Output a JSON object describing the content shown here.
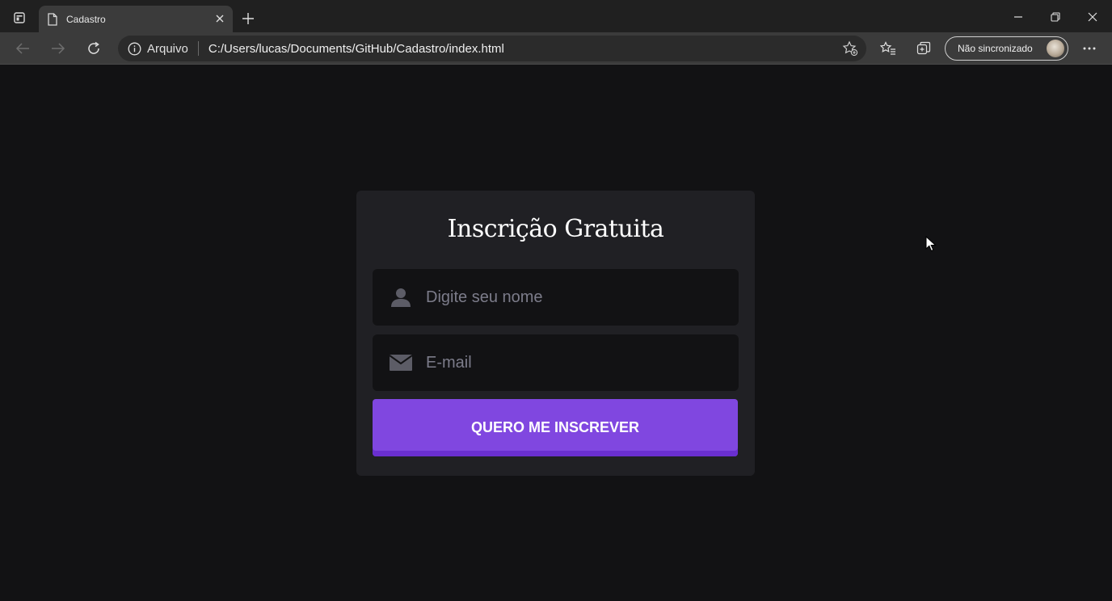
{
  "browser": {
    "tab_title": "Cadastro",
    "address_label": "Arquivo",
    "url": "C:/Users/lucas/Documents/GitHub/Cadastro/index.html",
    "sync_label": "Não sincronizado"
  },
  "form": {
    "title": "Inscrição Gratuita",
    "name_placeholder": "Digite seu nome",
    "email_placeholder": "E-mail",
    "submit_label": "QUERO ME INSCREVER"
  },
  "icons": {
    "name_field": "user-icon",
    "email_field": "envelope-icon"
  },
  "colors": {
    "page_background": "#121214",
    "card_background": "#202024",
    "input_background": "#121214",
    "button_accent": "#8047e0"
  }
}
